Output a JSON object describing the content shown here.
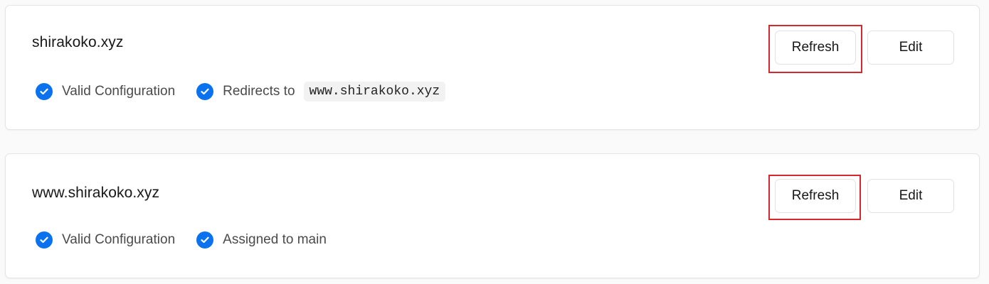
{
  "domains": [
    {
      "name": "shirakoko.xyz",
      "statuses": [
        {
          "label": "Valid Configuration"
        },
        {
          "label": "Redirects to",
          "code": "www.shirakoko.xyz"
        }
      ],
      "refresh_label": "Refresh",
      "edit_label": "Edit"
    },
    {
      "name": "www.shirakoko.xyz",
      "statuses": [
        {
          "label": "Valid Configuration"
        },
        {
          "label": "Assigned to main"
        }
      ],
      "refresh_label": "Refresh",
      "edit_label": "Edit"
    }
  ],
  "colors": {
    "check": "#0a72ef",
    "highlight": "#d7282f"
  }
}
